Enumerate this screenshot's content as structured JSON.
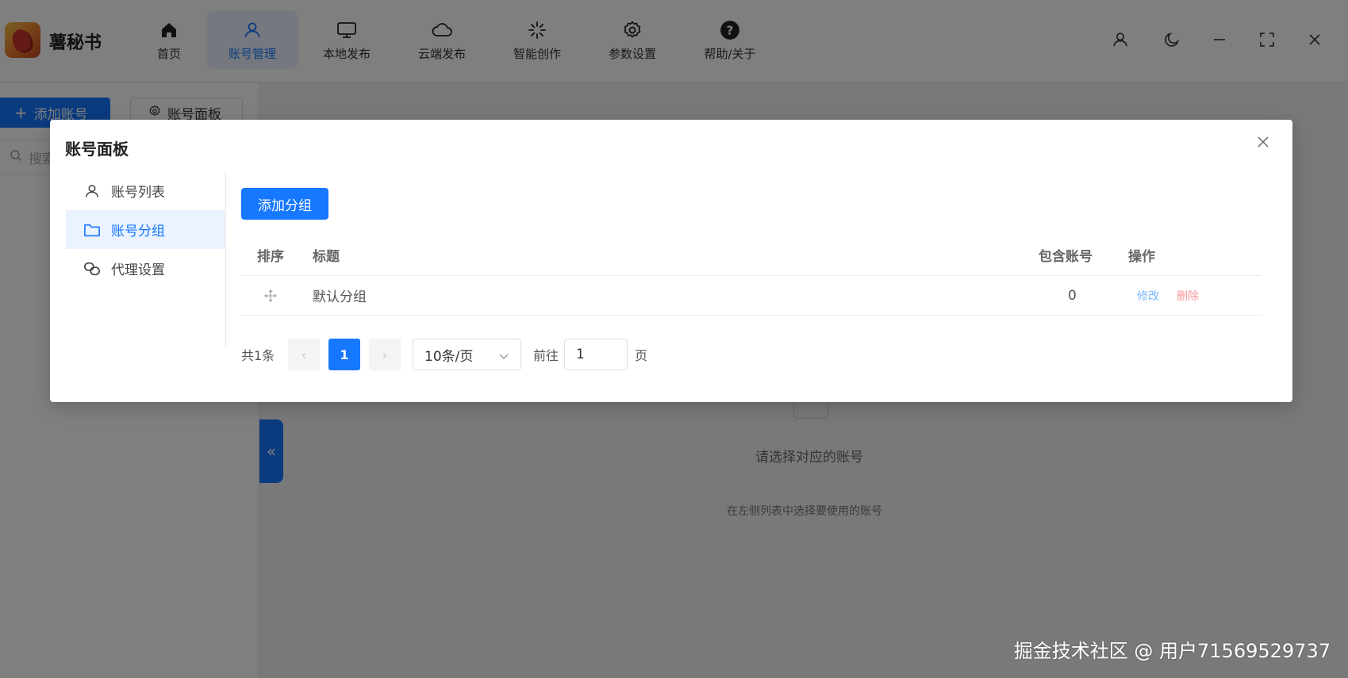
{
  "app": {
    "title": "薯秘书"
  },
  "nav": [
    {
      "label": "首页",
      "icon": "home-icon"
    },
    {
      "label": "账号管理",
      "icon": "user-icon",
      "active": true
    },
    {
      "label": "本地发布",
      "icon": "monitor-icon"
    },
    {
      "label": "云端发布",
      "icon": "cloud-icon"
    },
    {
      "label": "智能创作",
      "icon": "spinner-icon"
    },
    {
      "label": "参数设置",
      "icon": "gear-icon"
    },
    {
      "label": "帮助/关于",
      "icon": "help-icon"
    }
  ],
  "left_panel": {
    "add_account": "添加账号",
    "account_panel": "账号面板",
    "search_placeholder": "搜索"
  },
  "empty_state": {
    "title": "请选择对应的账号",
    "subtitle": "在左侧列表中选择要使用的账号"
  },
  "modal": {
    "title": "账号面板",
    "menu": [
      {
        "label": "账号列表",
        "icon": "user-icon"
      },
      {
        "label": "账号分组",
        "icon": "folder-icon",
        "active": true
      },
      {
        "label": "代理设置",
        "icon": "link-icon"
      }
    ],
    "add_group": "添加分组",
    "table": {
      "headers": {
        "sort": "排序",
        "title": "标题",
        "count": "包含账号",
        "action": "操作"
      },
      "rows": [
        {
          "title": "默认分组",
          "count": "0",
          "edit": "修改",
          "delete": "删除"
        }
      ]
    },
    "pagination": {
      "total": "共1条",
      "current": "1",
      "page_size": "10条/页",
      "goto_label": "前往",
      "goto_value": "1",
      "page_suffix": "页"
    }
  },
  "watermark": "掘金技术社区 @ 用户71569529737",
  "colors": {
    "primary": "#1677ff",
    "link": "#79b6ff",
    "danger": "#f89898"
  }
}
